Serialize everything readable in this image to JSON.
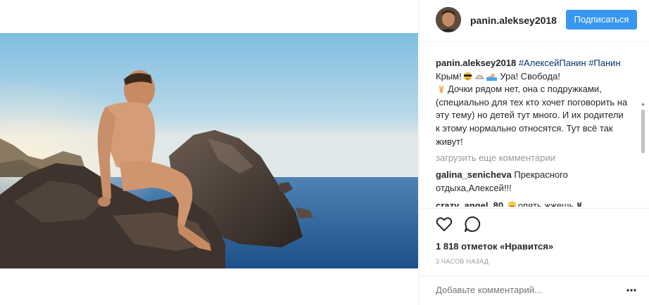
{
  "post": {
    "username": "panin.aleksey2018",
    "follow_label": "Подписаться",
    "caption": {
      "username": "panin.aleksey2018",
      "tag1": "#АлексейПанин",
      "tag2": "#Панин",
      "text1": "Крым!",
      "text2": "Ура! Свобода!",
      "text3": "Дочки рядом нет, она с подружками, (специально для тех кто хочет поговорить на эту тему) но детей тут много. И их родители к этому нормально относятся. Тут всё так живут!"
    },
    "load_more": "загрузить еще комментарии",
    "comments": [
      {
        "username": "galina_senicheva",
        "text": "Прекрасного отдыха,Алексей!!!"
      },
      {
        "username": "crazy_angel_80",
        "text": "опять жжешь"
      }
    ],
    "likes": "1 818 отметок «Нравится»",
    "time": "3 ЧАСОВ НАЗАД",
    "add_comment_placeholder": "Добавьте комментарий..."
  },
  "icons": {
    "like": "heart-outline-icon",
    "comment": "speech-bubble-icon",
    "more": "ellipsis-icon"
  },
  "colors": {
    "follow_button": "#3897f0",
    "hashtag": "#003569",
    "muted": "#999999",
    "border": "#efefef"
  }
}
